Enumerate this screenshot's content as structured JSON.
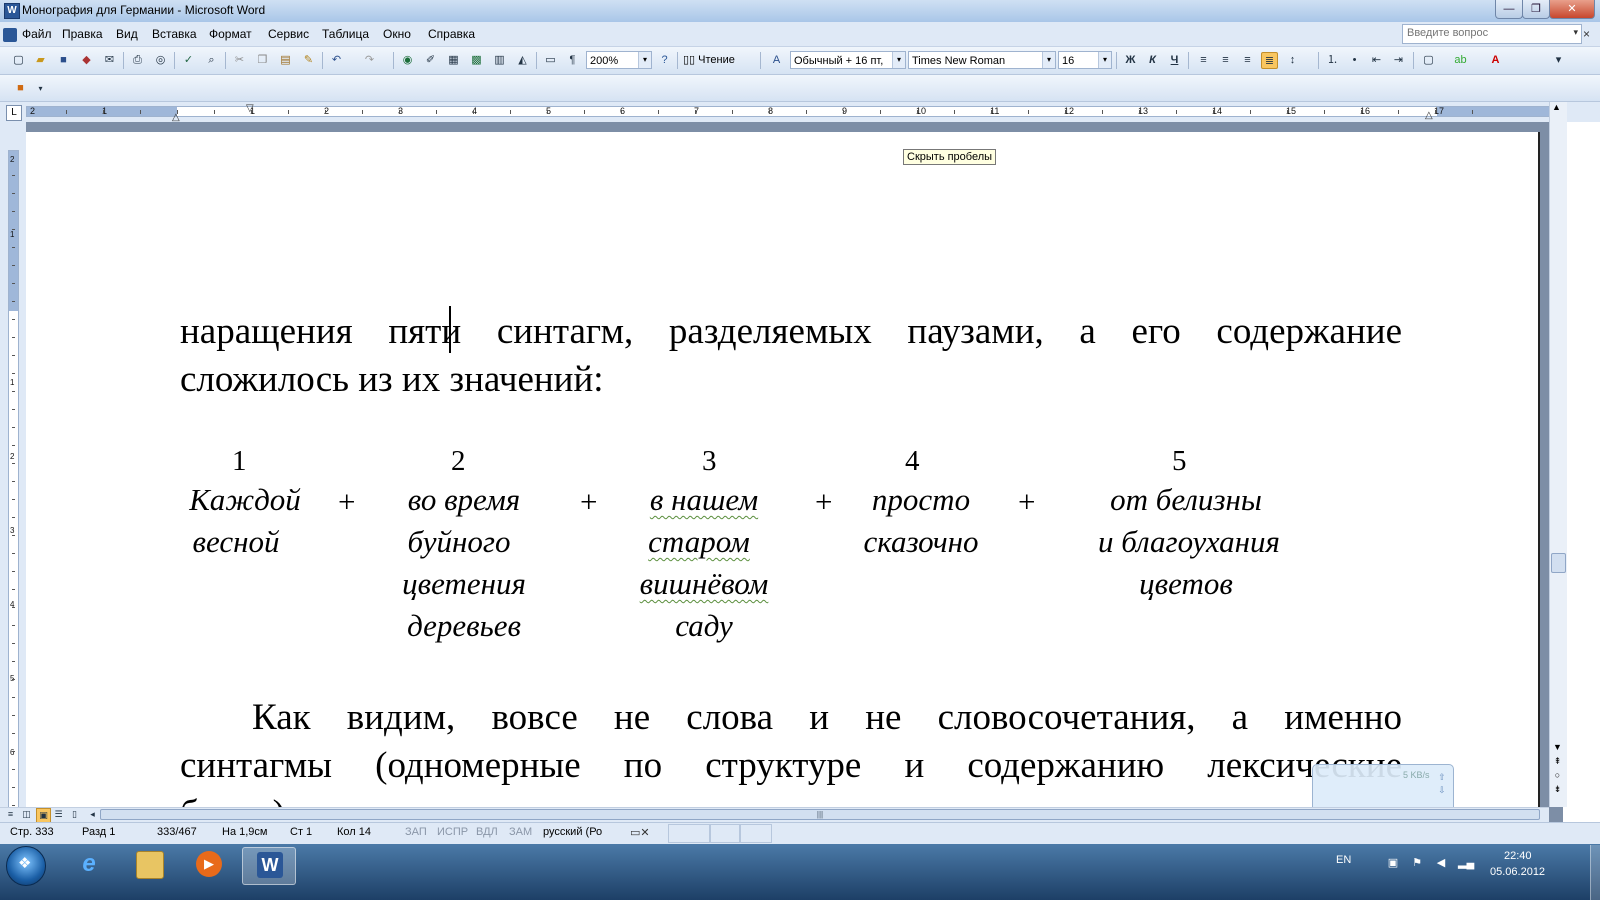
{
  "window": {
    "title": "Монография для Германии - Microsoft Word",
    "app_icon": "word-icon",
    "min_label": "—",
    "max_label": "❐",
    "close_label": "✕"
  },
  "menu": {
    "items": [
      "Файл",
      "Правка",
      "Вид",
      "Вставка",
      "Формат",
      "Сервис",
      "Таблица",
      "Окно",
      "Справка"
    ],
    "question_placeholder": "Введите вопрос",
    "doc_close": "×"
  },
  "toolbar": {
    "zoom": "200%",
    "reading_label": "Чтение",
    "style": "Обычный + 16 пт,",
    "font": "Times New Roman",
    "size": "16",
    "bold": "Ж",
    "italic": "К",
    "underline": "Ч",
    "pilcrow": "¶"
  },
  "ruler": {
    "numbers": [
      "2",
      "1",
      "1",
      "2",
      "3",
      "4",
      "5",
      "6",
      "7",
      "8",
      "9",
      "10",
      "11",
      "12",
      "13",
      "14",
      "15",
      "16",
      "17"
    ],
    "tab_selector": "L"
  },
  "vruler": {
    "numbers": [
      "2",
      "1",
      "1",
      "2",
      "3",
      "4",
      "5",
      "6"
    ]
  },
  "tooltip": "Скрыть пробелы",
  "document": {
    "para1_before_cursor": "наращения пят",
    "para1_after_cursor": "и синтагм, разделяемых паузами, а его содержание",
    "para1_line2": "сложилось из их значений:",
    "columns": [
      {
        "num": "1",
        "lines": [
          "Каждой",
          "весной"
        ]
      },
      {
        "num": "2",
        "lines": [
          "во время",
          "буйного",
          "цветения",
          "деревьев"
        ]
      },
      {
        "num": "3",
        "lines": [
          "в нашем",
          "старом",
          "вишнёвом",
          "саду"
        ]
      },
      {
        "num": "4",
        "lines": [
          "просто",
          "сказочно"
        ]
      },
      {
        "num": "5",
        "lines": [
          "от белизны",
          "и благоухания",
          "цветов"
        ]
      }
    ],
    "plus": "+",
    "para2_line1": "Как видим, вовсе не слова и не словосочетания, а именно",
    "para2_line2": "синтагмы (одномерные по структуре и содержанию лексические",
    "para2_line3": "блоки)"
  },
  "status": {
    "page": "Стр. 333",
    "section": "Разд 1",
    "pages": "333/467",
    "at": "На 1,9см",
    "line": "Ст 1",
    "col": "Кол 14",
    "rec": "ЗАП",
    "trk": "ИСПР",
    "ext": "ВДЛ",
    "ovr": "ЗАМ",
    "language": "русский (Ро"
  },
  "netwidget": {
    "speed": "5 KB/s"
  },
  "taskbar": {
    "lang": "EN",
    "time": "22:40",
    "date": "05.06.2012"
  },
  "colors": {
    "accent": "#2b5797",
    "doc_bg": "#7d8ea6",
    "taskbar": "#1d3f66",
    "spell_squiggle": "#5a8e3c"
  }
}
